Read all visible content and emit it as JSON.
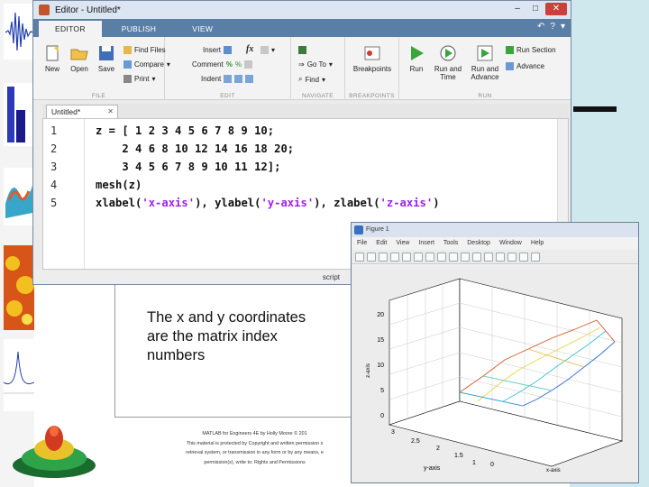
{
  "slide": {
    "body_text": "The x and y coordinates are the matrix index numbers",
    "footer_lines": [
      "MATLAB for Engineers 4E by Holly Moore © 201",
      "This material is protected by Copyright and written permission s",
      "retrieval system, or transmission in any form or by any means, e",
      "permission(s), write to: Rights and Permissions"
    ],
    "colors": {
      "teal": "#cfe8ee",
      "bar": "#111111"
    }
  },
  "editor": {
    "title": "Editor - Untitled*",
    "tabs": [
      "EDITOR",
      "PUBLISH",
      "VIEW"
    ],
    "ribbon": {
      "file": {
        "label": "FILE",
        "new": "New",
        "open": "Open",
        "save": "Save",
        "find_files": "Find Files",
        "compare": "Compare",
        "print": "Print"
      },
      "edit": {
        "label": "EDIT",
        "insert": "Insert",
        "fx": "fx",
        "comment": "Comment",
        "indent": "Indent"
      },
      "navigate": {
        "label": "NAVIGATE",
        "go_to": "Go To",
        "find": "Find"
      },
      "breakpoints": {
        "label": "BREAKPOINTS",
        "breakpoints": "Breakpoints"
      },
      "run": {
        "label": "RUN",
        "run": "Run",
        "run_and_time": "Run and Time",
        "run_and_advance": "Run and Advance",
        "run_section": "Run Section",
        "advance": "Advance"
      }
    },
    "document_tab": "Untitled*",
    "code_lines": [
      {
        "n": "1",
        "code": "z = [ 1 2 3 4 5 6 7 8 9 10;"
      },
      {
        "n": "2",
        "code": "    2 4 6 8 10 12 14 16 18 20;"
      },
      {
        "n": "3",
        "code": "    3 4 5 6 7 8 9 10 11 12];"
      },
      {
        "n": "4",
        "code": "mesh(z)"
      },
      {
        "n": "5",
        "pre": "xlabel(",
        "s1": "'x-axis'",
        "m1": "), ylabel(",
        "s2": "'y-axis'",
        "m2": "), zlabel(",
        "s3": "'z-axis'",
        "post": ")"
      }
    ],
    "status": "script"
  },
  "figure": {
    "title": "Figure 1",
    "menu": [
      "File",
      "Edit",
      "View",
      "Insert",
      "Tools",
      "Desktop",
      "Window",
      "Help"
    ],
    "axes": {
      "z_label": "z-axis",
      "y_label": "y-axis",
      "x_label": "x-axis",
      "z_ticks": [
        "20",
        "15",
        "10",
        "5",
        "0"
      ],
      "y_ticks": [
        "3",
        "2.5",
        "2",
        "1.5",
        "1"
      ],
      "x_ticks": [
        "0"
      ]
    }
  }
}
